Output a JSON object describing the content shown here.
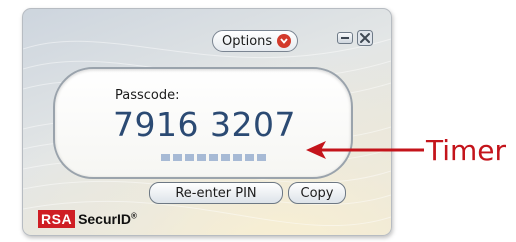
{
  "window": {
    "options_label": "Options",
    "passcode_label": "Passcode:",
    "passcode_value": "7916 3207",
    "timer_ticks": 9,
    "reenter_label": "Re-enter PIN",
    "copy_label": "Copy",
    "brand_rsa": "RSA",
    "brand_product": "SecurID",
    "brand_mark": "®"
  },
  "annotation": {
    "label": "Timer",
    "color": "#c4141b"
  },
  "colors": {
    "passcode_text": "#2b4a73",
    "timer_tick": "#a7bad5",
    "options_chevron": "#d33a2b",
    "brand_red": "#cf1e24"
  },
  "icons": {
    "options_dropdown": "chevron-down-icon",
    "minimize": "minimize-icon",
    "close": "close-icon"
  }
}
